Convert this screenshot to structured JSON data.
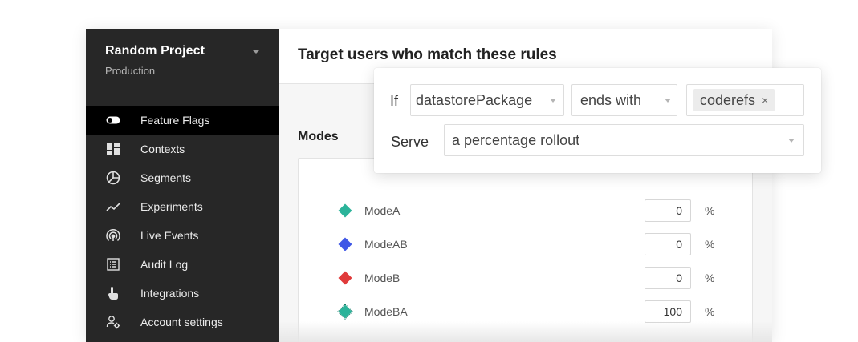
{
  "project": {
    "name": "Random Project",
    "environment": "Production"
  },
  "sidebar": {
    "items": [
      {
        "label": "Feature Flags",
        "icon": "toggle-icon",
        "active": true
      },
      {
        "label": "Contexts",
        "icon": "dashboard-icon"
      },
      {
        "label": "Segments",
        "icon": "pie-icon"
      },
      {
        "label": "Experiments",
        "icon": "trend-icon"
      },
      {
        "label": "Live Events",
        "icon": "broadcast-icon"
      },
      {
        "label": "Audit Log",
        "icon": "list-icon"
      },
      {
        "label": "Integrations",
        "icon": "pointer-icon"
      },
      {
        "label": "Account settings",
        "icon": "user-gear-icon"
      }
    ]
  },
  "main": {
    "title": "Target users who match these rules",
    "modes_title": "Modes",
    "modes": [
      {
        "name": "ModeA",
        "value": "0",
        "unit": "%",
        "color": "#2bb39a"
      },
      {
        "name": "ModeAB",
        "value": "0",
        "unit": "%",
        "color": "#3f57e6"
      },
      {
        "name": "ModeB",
        "value": "0",
        "unit": "%",
        "color": "#e03a3a"
      },
      {
        "name": "ModeBA",
        "value": "100",
        "unit": "%",
        "color": "#2bb39a"
      }
    ]
  },
  "rule": {
    "if_label": "If",
    "attribute": "datastorePackage",
    "operator": "ends with",
    "value_chip": "coderefs",
    "chip_remove": "×",
    "serve_label": "Serve",
    "serve_value": "a percentage rollout"
  }
}
